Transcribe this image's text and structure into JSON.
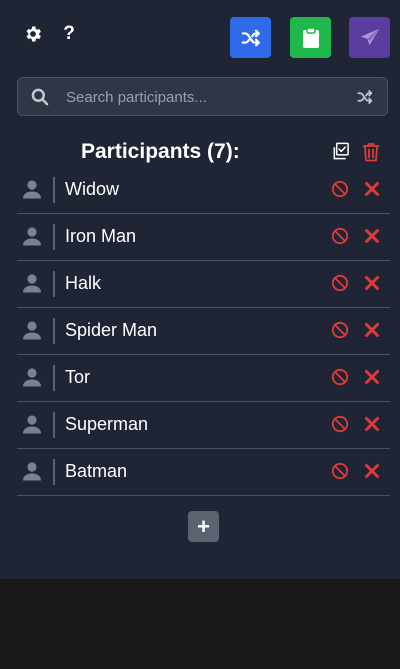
{
  "colors": {
    "panel_bg": "#1f2534",
    "shuffle_btn": "#2f6be8",
    "clipboard_btn": "#1fb84d",
    "send_btn": "#5a3d9e",
    "danger": "#e03a3a",
    "muted_icon": "#7b8190"
  },
  "toolbar": {
    "help_label": "?",
    "icons": [
      "gear-icon",
      "shuffle-icon",
      "clipboard-icon",
      "send-icon"
    ]
  },
  "search": {
    "placeholder": "Search participants...",
    "value": ""
  },
  "participants": {
    "title": "Participants (7):",
    "items": [
      {
        "name": "Widow"
      },
      {
        "name": "Iron Man"
      },
      {
        "name": "Halk"
      },
      {
        "name": "Spider Man"
      },
      {
        "name": "Tor"
      },
      {
        "name": "Superman"
      },
      {
        "name": "Batman"
      }
    ]
  },
  "add_button": {
    "label": "+"
  }
}
